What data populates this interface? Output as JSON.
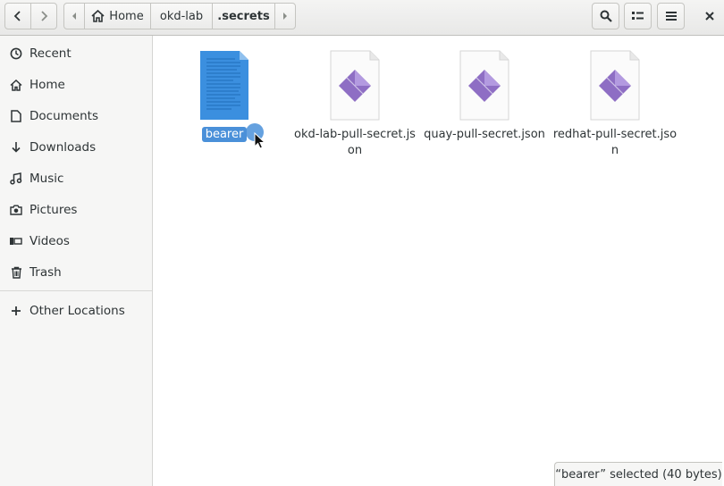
{
  "header": {
    "path": [
      "Home",
      "okd-lab",
      ".secrets"
    ]
  },
  "sidebar": {
    "items": [
      {
        "label": "Recent",
        "icon": "clock-icon"
      },
      {
        "label": "Home",
        "icon": "home-icon"
      },
      {
        "label": "Documents",
        "icon": "document-icon"
      },
      {
        "label": "Downloads",
        "icon": "download-icon"
      },
      {
        "label": "Music",
        "icon": "music-icon"
      },
      {
        "label": "Pictures",
        "icon": "camera-icon"
      },
      {
        "label": "Videos",
        "icon": "video-icon"
      },
      {
        "label": "Trash",
        "icon": "trash-icon"
      }
    ],
    "other_locations": "Other Locations"
  },
  "files": [
    {
      "name": "bearer",
      "type": "text",
      "selected": true
    },
    {
      "name": "okd-lab-pull-secret.json",
      "type": "json",
      "selected": false
    },
    {
      "name": "quay-pull-secret.json",
      "type": "json",
      "selected": false
    },
    {
      "name": "redhat-pull-secret.json",
      "type": "json",
      "selected": false
    }
  ],
  "status": "“bearer” selected  (40 bytes)",
  "colors": {
    "accent": "#4a90d9",
    "json_icon": "#8e6ec4"
  }
}
